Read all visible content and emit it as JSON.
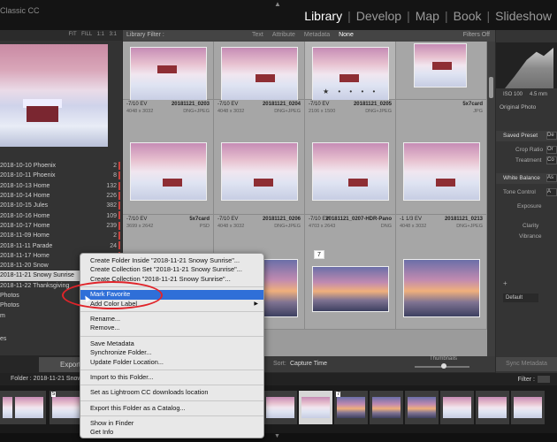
{
  "app": {
    "title": "Classic CC"
  },
  "modules": {
    "library": "Library",
    "develop": "Develop",
    "map": "Map",
    "book": "Book",
    "slideshow": "Slideshow",
    "sep": "|"
  },
  "navigator": {
    "zoom_fit": "FIT",
    "zoom_fill": "FILL",
    "zoom_1": "1:1",
    "zoom_3": "3:1"
  },
  "folders": [
    {
      "name": "2018-10-10 Phoenix",
      "count": "2"
    },
    {
      "name": "2018-10-11 Phoenix",
      "count": "8"
    },
    {
      "name": "2018-10-13 Home",
      "count": "132"
    },
    {
      "name": "2018-10-14 Home",
      "count": "226"
    },
    {
      "name": "2018-10-15 Jules",
      "count": "382"
    },
    {
      "name": "2018-10-16 Home",
      "count": "109"
    },
    {
      "name": "2018-10-17 Home",
      "count": "239"
    },
    {
      "name": "2018-11-09 Home",
      "count": "2"
    },
    {
      "name": "2018-11-11 Parade",
      "count": "24"
    },
    {
      "name": "2018-11-17 Home",
      "count": "2"
    },
    {
      "name": "2018-11-20 Snow",
      "count": ""
    },
    {
      "name": "2018-11-21 Snowy Sunrise",
      "count": ""
    },
    {
      "name": "2018-11-22 Thanksgiving",
      "count": ""
    },
    {
      "name": "Photos",
      "count": ""
    },
    {
      "name": "Photos",
      "count": ""
    },
    {
      "name": "m",
      "count": ""
    }
  ],
  "left_panel": {
    "bottom_label": "es"
  },
  "filterbar": {
    "label": "Library Filter :",
    "text": "Text",
    "attribute": "Attribute",
    "metadata": "Metadata",
    "none": "None",
    "filters_off": "Filters Off"
  },
  "grid": {
    "row1": [
      {
        "ev": "-7/10 EV",
        "name": "20181121_0203",
        "dims": "4048 x 3032",
        "type": "DNG+JPEG"
      },
      {
        "ev": "-7/10 EV",
        "name": "20181121_0204",
        "dims": "4048 x 3032",
        "type": "DNG+JPEG"
      },
      {
        "ev": "-7/10 EV",
        "name": "20181121_0205",
        "dims": "2106 x 1500",
        "type": "DNG+JPEG"
      },
      {
        "ev": "",
        "name": "5x7card",
        "dims": "",
        "type": "JPG"
      }
    ],
    "row2": [
      {
        "ev": "-7/10 EV",
        "name": "5x7card",
        "dims": "3699 x 2642",
        "type": "PSD"
      },
      {
        "ev": "-7/10 EV",
        "name": "20181121_0206",
        "dims": "4048 x 3032",
        "type": "DNG+JPEG"
      },
      {
        "ev": "-7/10 EV",
        "name": "20181121_0207-HDR-Pano",
        "dims": "4703 x 2643",
        "type": "DNG"
      },
      {
        "ev": "-1 1/3 EV",
        "name": "20181121_0213",
        "dims": "4048 x 3032",
        "type": "DNG+JPEG"
      }
    ],
    "stars": "★ • • • •",
    "badge_7": "7"
  },
  "right_panel": {
    "iso": "ISO 100",
    "focal": "4.5 mm",
    "original_photo": "Original Photo",
    "saved_preset": "Saved Preset",
    "saved_preset_val": "De",
    "crop_ratio": "Crop Ratio",
    "crop_val": "Or",
    "treatment": "Treatment",
    "treatment_val": "Co",
    "white_balance": "White Balance",
    "wb_val": "As",
    "tone_control": "Tone Control",
    "tone_val": "A",
    "exposure": "Exposure",
    "clarity": "Clarity",
    "vibrance": "Vibrance",
    "plus": "+",
    "default": "Default",
    "sync_metadata": "Sync Metadata"
  },
  "toolbar": {
    "export": "Export",
    "sort_label": "Sort:",
    "sort_value": "Capture Time",
    "thumbnails": "Thumbnails"
  },
  "filmstrip": {
    "path": "Folder : 2018-11-21 Snowy Sunrise",
    "filter": "Filter :",
    "badge_5": "5",
    "badge_7": "7"
  },
  "context_menu": {
    "items": [
      "Create Folder Inside \"2018-11-21 Snowy Sunrise\"...",
      "Create Collection Set \"2018-11-21 Snowy Sunrise\"...",
      "Create Collection \"2018-11-21 Snowy Sunrise\"...",
      "Mark Favorite",
      "Add Color Label",
      "Rename...",
      "Remove...",
      "Save Metadata",
      "Synchronize Folder...",
      "Update Folder Location...",
      "Import to this Folder...",
      "Set as Lightroom CC downloads location",
      "Export this Folder as a Catalog...",
      "Show in Finder",
      "Get Info"
    ],
    "submenu_arrow": "▶"
  },
  "colors": {
    "highlight": "#2f6fd8",
    "annotation": "#e0242a",
    "label_red": "#c9423e"
  }
}
